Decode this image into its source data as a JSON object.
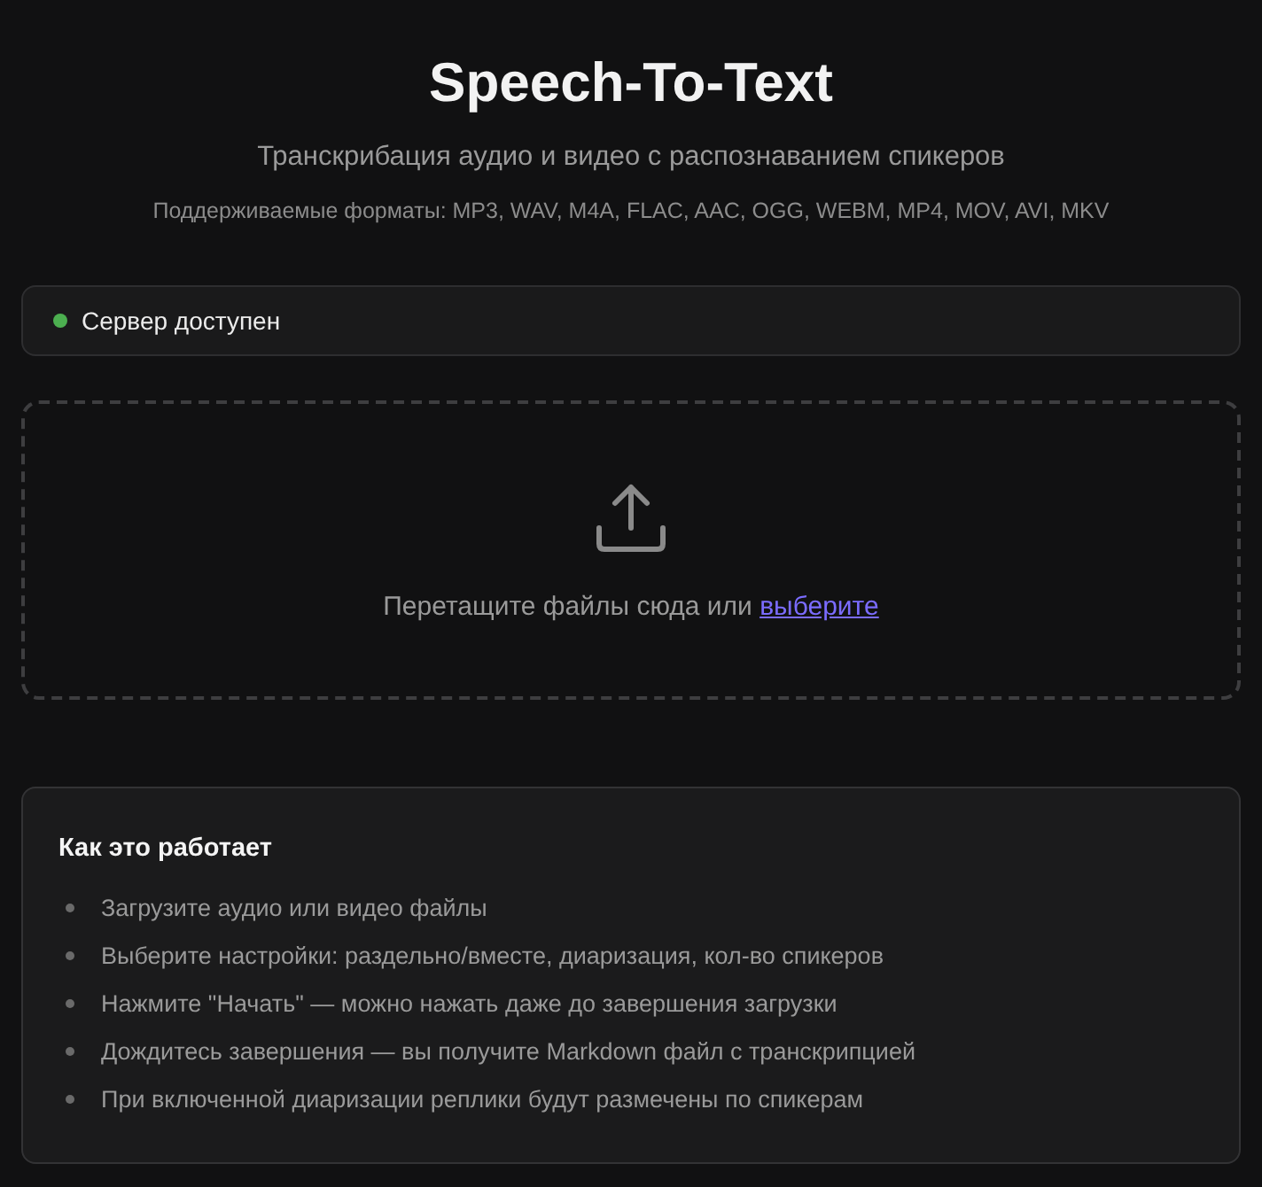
{
  "header": {
    "title": "Speech-To-Text",
    "subtitle": "Транскрибация аудио и видео с распознаванием спикеров",
    "formats": "Поддерживаемые форматы: MP3, WAV, M4A, FLAC, AAC, OGG, WEBM, MP4, MOV, AVI, MKV"
  },
  "server_status": {
    "label": "Сервер доступен",
    "online": true
  },
  "dropzone": {
    "hint": "Перетащите файлы сюда или",
    "link": "выберите"
  },
  "how_it_works": {
    "title": "Как это работает",
    "steps": [
      "Загрузите аудио или видео файлы",
      "Выберите настройки: раздельно/вместе, диаризация, кол-во спикеров",
      "Нажмите \"Начать\" — можно нажать даже до завершения загрузки",
      "Дождитесь завершения — вы получите Markdown файл с транскрипцией",
      "При включенной диаризации реплики будут размечены по спикерам"
    ]
  }
}
